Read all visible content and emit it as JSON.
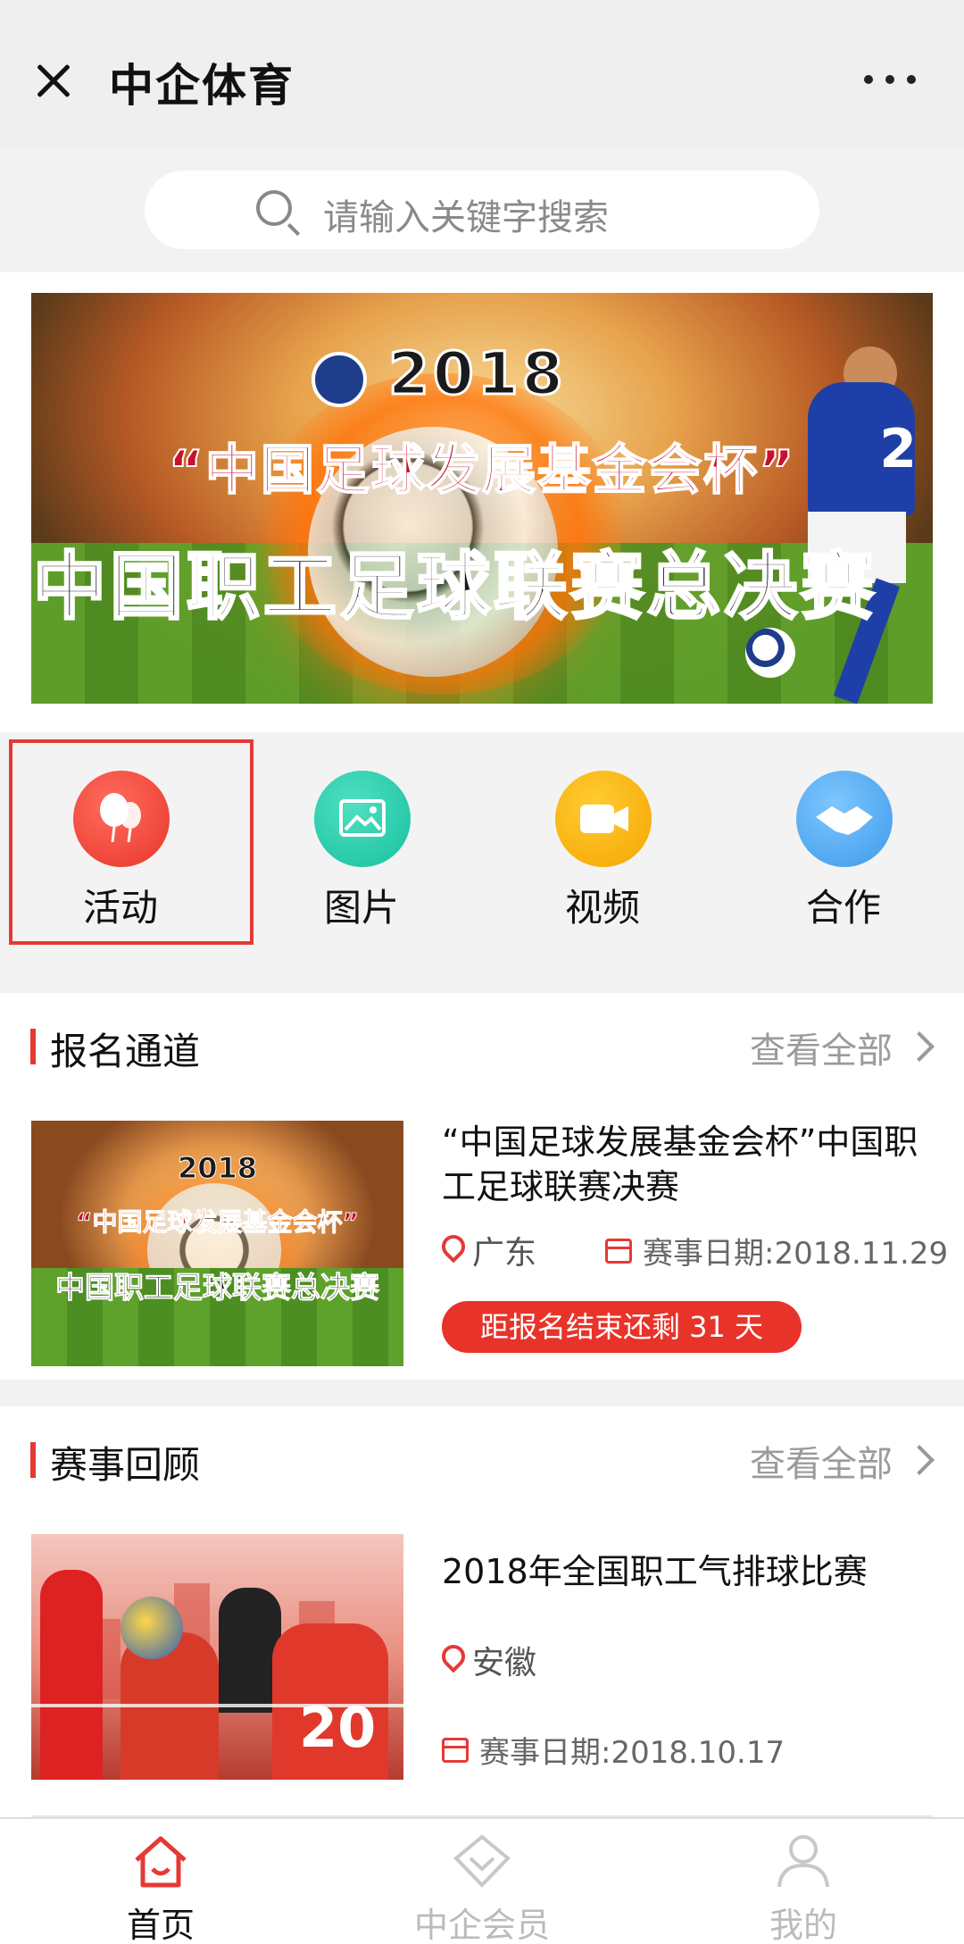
{
  "header": {
    "title": "中企体育"
  },
  "search": {
    "placeholder": "请输入关键字搜索"
  },
  "banner": {
    "year": "2018",
    "subtitle": "“中国足球发展基金会杯”",
    "main": "中国职工足球联赛总决赛",
    "player_number": "2"
  },
  "nav": [
    {
      "label": "活动",
      "icon": "balloon-icon",
      "color": "#e8352a"
    },
    {
      "label": "图片",
      "icon": "image-icon",
      "color": "#17c09f"
    },
    {
      "label": "视频",
      "icon": "video-camera-icon",
      "color": "#f5a500"
    },
    {
      "label": "合作",
      "icon": "handshake-icon",
      "color": "#3d9be9"
    }
  ],
  "registration": {
    "title": "报名通道",
    "see_all": "查看全部",
    "item": {
      "thumb_year": "2018",
      "thumb_sub": "“中国足球发展基金会杯”",
      "thumb_main": "中国职工足球联赛总决赛",
      "title": "“中国足球发展基金会杯”中国职工足球联赛决赛",
      "location": "广东",
      "date": "赛事日期:2018.11.29",
      "countdown": "距报名结束还剩 31 天"
    }
  },
  "review": {
    "title": "赛事回顾",
    "see_all": "查看全部",
    "item": {
      "thumb_number": "20",
      "title": "2018年全国职工气排球比赛",
      "location": "安徽",
      "date": "赛事日期:2018.10.17"
    }
  },
  "tabbar": [
    {
      "label": "首页",
      "active": true
    },
    {
      "label": "中企会员",
      "active": false
    },
    {
      "label": "我的",
      "active": false
    }
  ],
  "colors": {
    "accent": "#e53935",
    "countdown_bg": "#e8332a"
  }
}
